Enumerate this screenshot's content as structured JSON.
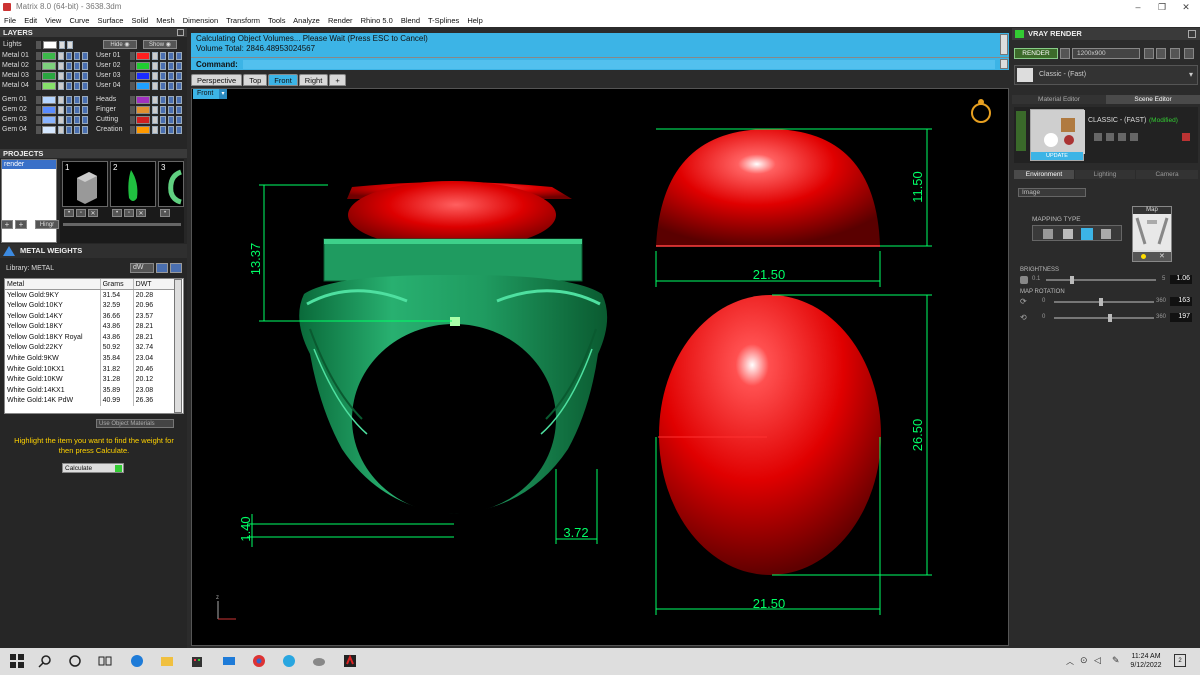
{
  "window": {
    "title": "Matrix 8.0 (64-bit) - 3638.3dm"
  },
  "menu": [
    "File",
    "Edit",
    "View",
    "Curve",
    "Surface",
    "Solid",
    "Mesh",
    "Dimension",
    "Transform",
    "Tools",
    "Analyze",
    "Render",
    "Rhino 5.0",
    "Blend",
    "T-Splines",
    "Help"
  ],
  "layers": {
    "title": "LAYERS",
    "lights_label": "Lights",
    "hide_label": "Hide",
    "show_label": "Show",
    "left": [
      {
        "name": "Metal 01",
        "color": "#3cb84a"
      },
      {
        "name": "Metal 02",
        "color": "#7dd17d"
      },
      {
        "name": "Metal 03",
        "color": "#2aa640"
      },
      {
        "name": "Metal 04",
        "color": "#86e06b"
      },
      {
        "name": "Gem 01",
        "color": "#b5d5ff"
      },
      {
        "name": "Gem 02",
        "color": "#5a8cff"
      },
      {
        "name": "Gem 03",
        "color": "#8ab4ff"
      },
      {
        "name": "Gem 04",
        "color": "#d6e8ff"
      }
    ],
    "right": [
      {
        "name": "User 01",
        "color": "#ff2020"
      },
      {
        "name": "User 02",
        "color": "#20cc30"
      },
      {
        "name": "User 03",
        "color": "#1a2cff"
      },
      {
        "name": "User 04",
        "color": "#20a0ff"
      },
      {
        "name": "Heads",
        "color": "#a030c0"
      },
      {
        "name": "Finger",
        "color": "#e09030"
      },
      {
        "name": "Cutting",
        "color": "#d02020"
      },
      {
        "name": "Creation",
        "color": "#ff9900"
      }
    ]
  },
  "projects": {
    "title": "PROJECTS",
    "item": "render",
    "thumbs": [
      "1",
      "2",
      "3"
    ],
    "hinge": "Hingr"
  },
  "metal_weights": {
    "title": "METAL WEIGHTS",
    "library_label": "Library: METAL",
    "unit": "dW",
    "columns": [
      "Metal",
      "Grams",
      "DWT"
    ],
    "rows": [
      [
        "Yellow Gold:9KY",
        "31.54",
        "20.28"
      ],
      [
        "Yellow Gold:10KY",
        "32.59",
        "20.96"
      ],
      [
        "Yellow Gold:14KY",
        "36.66",
        "23.57"
      ],
      [
        "Yellow Gold:18KY",
        "43.86",
        "28.21"
      ],
      [
        "Yellow Gold:18KY Royal",
        "43.86",
        "28.21"
      ],
      [
        "Yellow Gold:22KY",
        "50.92",
        "32.74"
      ],
      [
        "White Gold:9KW",
        "35.84",
        "23.04"
      ],
      [
        "White Gold:10KX1",
        "31.82",
        "20.46"
      ],
      [
        "White Gold:10KW",
        "31.28",
        "20.12"
      ],
      [
        "White Gold:14KX1",
        "35.89",
        "23.08"
      ],
      [
        "White Gold:14K PdW",
        "40.99",
        "26.36"
      ]
    ],
    "use_object_materials": "Use Object Materials",
    "hint": "Highlight the item you want to find the weight for then press Calculate.",
    "calculate": "Calculate"
  },
  "command": {
    "line1": "Calculating Object Volumes... Please Wait (Press ESC to Cancel)",
    "line2": "Volume Total: 2846.48953024567",
    "label": "Command:"
  },
  "viewport_tabs": [
    "Perspective",
    "Top",
    "Front",
    "Right"
  ],
  "active_view": "Front",
  "dimensions": {
    "ring_height": "13.37",
    "cap_height": "11.50",
    "cap_width_top": "21.50",
    "cap_depth": "26.50",
    "cap_width_bottom": "21.50",
    "shank_bottom": "1.40",
    "shank_side": "3.72"
  },
  "vray": {
    "title": "VRAY RENDER",
    "render_btn": "RENDER",
    "resolution": "1200x900",
    "preset_label": "Classic - (Fast)",
    "tabs": [
      "Material Editor",
      "Scene Editor"
    ],
    "material_name": "CLASSIC - (FAST)",
    "modified": "(Modified)",
    "update": "UPDATE",
    "env_tabs": [
      "Environment",
      "Lighting",
      "Camera"
    ],
    "env_type": "Image",
    "mapping_type": "MAPPING TYPE",
    "map_label": "Map",
    "brightness_label": "BRIGHTNESS",
    "brightness_min": "0.1",
    "brightness_max": "5",
    "brightness_value": "1.06",
    "brightness_level": 0.22,
    "rotation_label": "MAP ROTATION",
    "rot1_min": "0",
    "rot1_max": "360",
    "rot1_value": "163",
    "rot2_min": "0",
    "rot2_max": "360",
    "rot2_value": "197"
  },
  "taskbar": {
    "time": "11:24 AM",
    "date": "9/12/2022",
    "notif": "2"
  }
}
